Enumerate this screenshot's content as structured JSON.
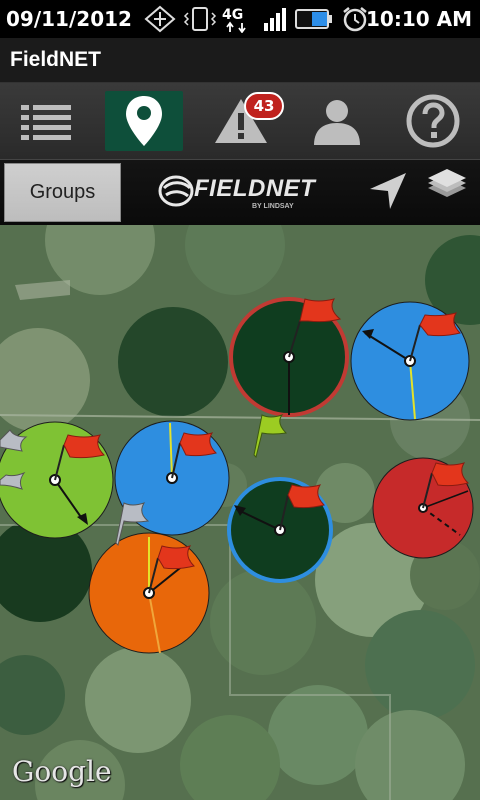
{
  "status_bar": {
    "date": "09/11/2012",
    "time": "10:10 AM",
    "network": "4G",
    "icons": [
      "data-sync-icon",
      "vibrate-icon",
      "4g-icon",
      "signal-icon",
      "battery-icon",
      "alarm-icon"
    ]
  },
  "app": {
    "title": "FieldNET"
  },
  "tabs": [
    {
      "name": "list-icon",
      "active": false
    },
    {
      "name": "map-pin-icon",
      "active": true
    },
    {
      "name": "alert-icon",
      "active": false,
      "badge": "43"
    },
    {
      "name": "user-icon",
      "active": false
    },
    {
      "name": "help-icon",
      "active": false
    }
  ],
  "toolbar": {
    "groups_label": "Groups",
    "logo_text": "FIELDNET",
    "logo_subtext": "BY LINDSAY",
    "icons": [
      "locate-icon",
      "layers-icon"
    ]
  },
  "map": {
    "attribution": "Google",
    "pivot_status_colors": {
      "irrigating": "#2e8ee0",
      "stopped_dry": "#7fc234",
      "running_wet": "#e8670a",
      "fault": "#c62a2a",
      "inactive": "#0f3d1f"
    },
    "flag_colors": {
      "red": "#e3361c",
      "green_yellow": "#9ccc22",
      "grey": "#b8bcc4"
    }
  },
  "colors": {
    "accent": "#0e4f3a",
    "badge": "#c0221e"
  }
}
